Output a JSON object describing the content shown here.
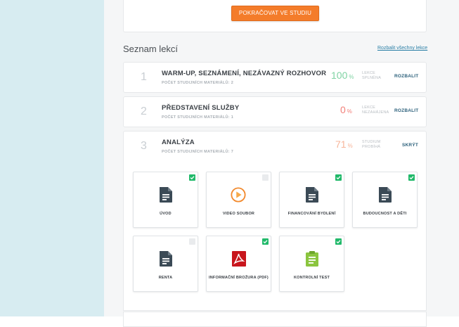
{
  "continue_button": "POKRAČOVAT VE STUDIU",
  "lesson_list": {
    "title": "Seznam lekcí",
    "expand_all": "Rozbalit všechny lekce"
  },
  "lessons": [
    {
      "number": "1",
      "title": "WARM-UP, SEZNÁMENÍ, NEZÁVAZNÝ ROZHOVOR",
      "materials": "POČET STUDIJNÍCH MATERIÁLŮ: 2",
      "percent": "100",
      "percent_sign": "%",
      "status_line1": "LEKCE",
      "status_line2": "SPLNĚNA",
      "toggle": "ROZBALIT",
      "color": "#7fd3a3"
    },
    {
      "number": "2",
      "title": "PŘEDSTAVENÍ SLUŽBY",
      "materials": "POČET STUDIJNÍCH MATERIÁLŮ: 1",
      "percent": "0",
      "percent_sign": "%",
      "status_line1": "LEKCE",
      "status_line2": "NEZAHÁJENA",
      "toggle": "ROZBALIT",
      "color": "#f2807a"
    },
    {
      "number": "3",
      "title": "ANALÝZA",
      "materials": "POČET STUDIJNÍCH MATERIÁLŮ: 7",
      "percent": "71",
      "percent_sign": "%",
      "status_line1": "STUDIUM",
      "status_line2": "PROBÍHÁ",
      "toggle": "SKRÝT",
      "color": "#f7b59a"
    }
  ],
  "materials": [
    {
      "label": "ÚVOD",
      "icon": "document-icon",
      "completed": true
    },
    {
      "label": "VIDEO SOUBOR",
      "icon": "video-play-icon",
      "completed": false
    },
    {
      "label": "FINANCOVÁNÍ BYDLENÍ",
      "icon": "document-icon",
      "completed": true
    },
    {
      "label": "BUDOUCNOST A DĚTI",
      "icon": "document-icon",
      "completed": true
    },
    {
      "label": "RENTA",
      "icon": "document-icon",
      "completed": false
    },
    {
      "label": "INFORMAČNÍ BROŽURA (PDF)",
      "icon": "pdf-icon",
      "completed": true
    },
    {
      "label": "KONTROLNÍ TEST",
      "icon": "clipboard-test-icon",
      "completed": true
    }
  ],
  "colors": {
    "accent": "#f47c2a",
    "check_green": "#21b96a",
    "doc_icon": "#3b4a56",
    "pdf_red": "#c8161d",
    "test_green": "#8bc53f",
    "video_orange": "#f28a2e"
  }
}
